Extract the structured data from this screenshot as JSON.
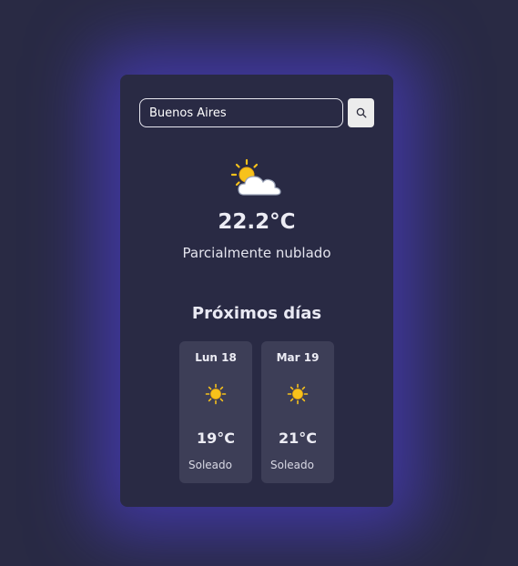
{
  "search": {
    "value": "Buenos Aires",
    "button_icon": "search-icon"
  },
  "current": {
    "icon": "partly-cloudy-icon",
    "temperature": "22.2°C",
    "description": "Parcialmente nublado"
  },
  "forecast": {
    "title": "Próximos días",
    "days": [
      {
        "label": "Lun 18",
        "icon": "sun-icon",
        "temperature": "19°C",
        "description": "Soleado"
      },
      {
        "label": "Mar 19",
        "icon": "sun-icon",
        "temperature": "21°C",
        "description": "Soleado"
      }
    ]
  },
  "colors": {
    "background": "#292a44",
    "glow": "#4a3cbe",
    "day_card": "#3d3e57",
    "sun": "#f7c21b",
    "cloud": "#ffffff"
  }
}
